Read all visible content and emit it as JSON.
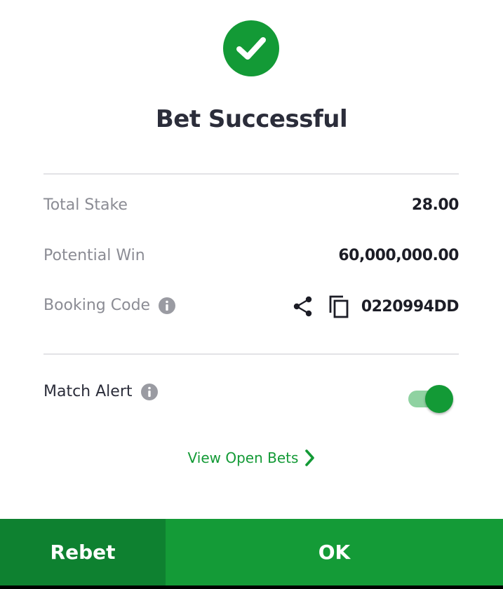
{
  "header": {
    "title": "Bet Successful"
  },
  "summary": {
    "total_stake": {
      "label": "Total Stake",
      "value": "28.00"
    },
    "potential_win": {
      "label": "Potential Win",
      "value": "60,000,000.00"
    },
    "booking_code": {
      "label": "Booking Code",
      "value": "0220994DD"
    }
  },
  "match_alert": {
    "label": "Match Alert",
    "enabled": true
  },
  "links": {
    "view_open_bets": "View Open Bets"
  },
  "footer": {
    "rebet_label": "Rebet",
    "ok_label": "OK"
  },
  "colors": {
    "brand_green": "#139a36",
    "rebet_green": "#0e8130",
    "toggle_track": "#8fd2a1",
    "muted_text": "#8b8c94",
    "dark_text": "#2b2d3a"
  },
  "icons": [
    "check-icon",
    "info-icon",
    "share-icon",
    "copy-icon",
    "chevron-right-icon"
  ]
}
